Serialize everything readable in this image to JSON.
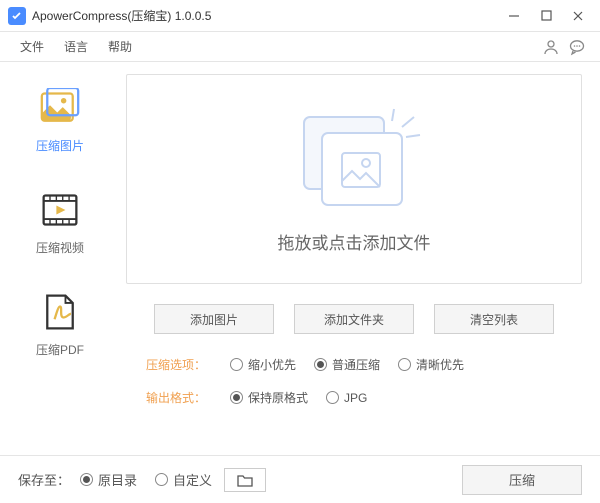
{
  "titlebar": {
    "title": "ApowerCompress(压缩宝)  1.0.0.5"
  },
  "menu": {
    "file": "文件",
    "language": "语言",
    "help": "帮助"
  },
  "sidebar": {
    "items": [
      {
        "label": "压缩图片"
      },
      {
        "label": "压缩视频"
      },
      {
        "label": "压缩PDF"
      }
    ]
  },
  "main": {
    "drop_text": "拖放或点击添加文件",
    "add_image": "添加图片",
    "add_folder": "添加文件夹",
    "clear_list": "清空列表"
  },
  "options": {
    "compress_label": "压缩选项：",
    "compress": {
      "shrink": "缩小优先",
      "normal": "普通压缩",
      "quality": "清晰优先"
    },
    "output_label": "输出格式：",
    "output": {
      "keep": "保持原格式",
      "jpg": "JPG"
    }
  },
  "footer": {
    "save_to": "保存至：",
    "original_dir": "原目录",
    "custom_dir": "自定义",
    "compress_btn": "压缩"
  }
}
